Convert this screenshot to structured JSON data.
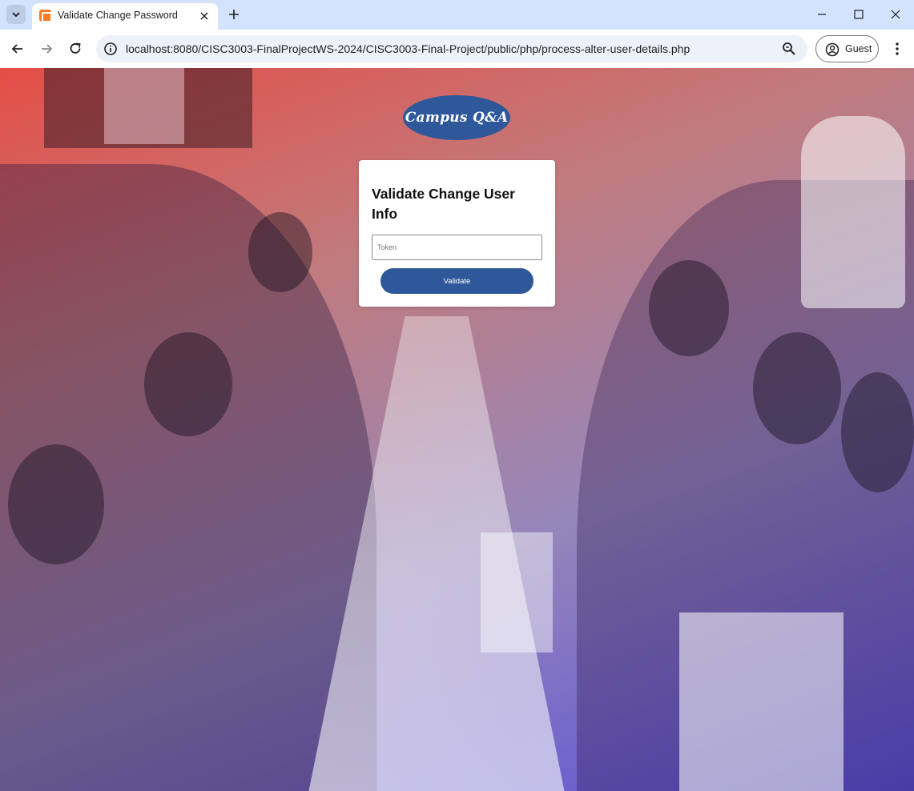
{
  "browser": {
    "tab_title": "Validate Change Password",
    "url": "localhost:8080/CISC3003-FinalProjectWS-2024/CISC3003-Final-Project/public/php/process-alter-user-details.php",
    "profile_label": "Guest"
  },
  "page": {
    "logo_text": "Campus Q&A",
    "form": {
      "title": "Validate Change User Info",
      "token_placeholder": "Token",
      "token_value": "",
      "submit_label": "Validate"
    }
  },
  "colors": {
    "accent": "#2e5899",
    "tab_strip": "#d3e3fd"
  }
}
